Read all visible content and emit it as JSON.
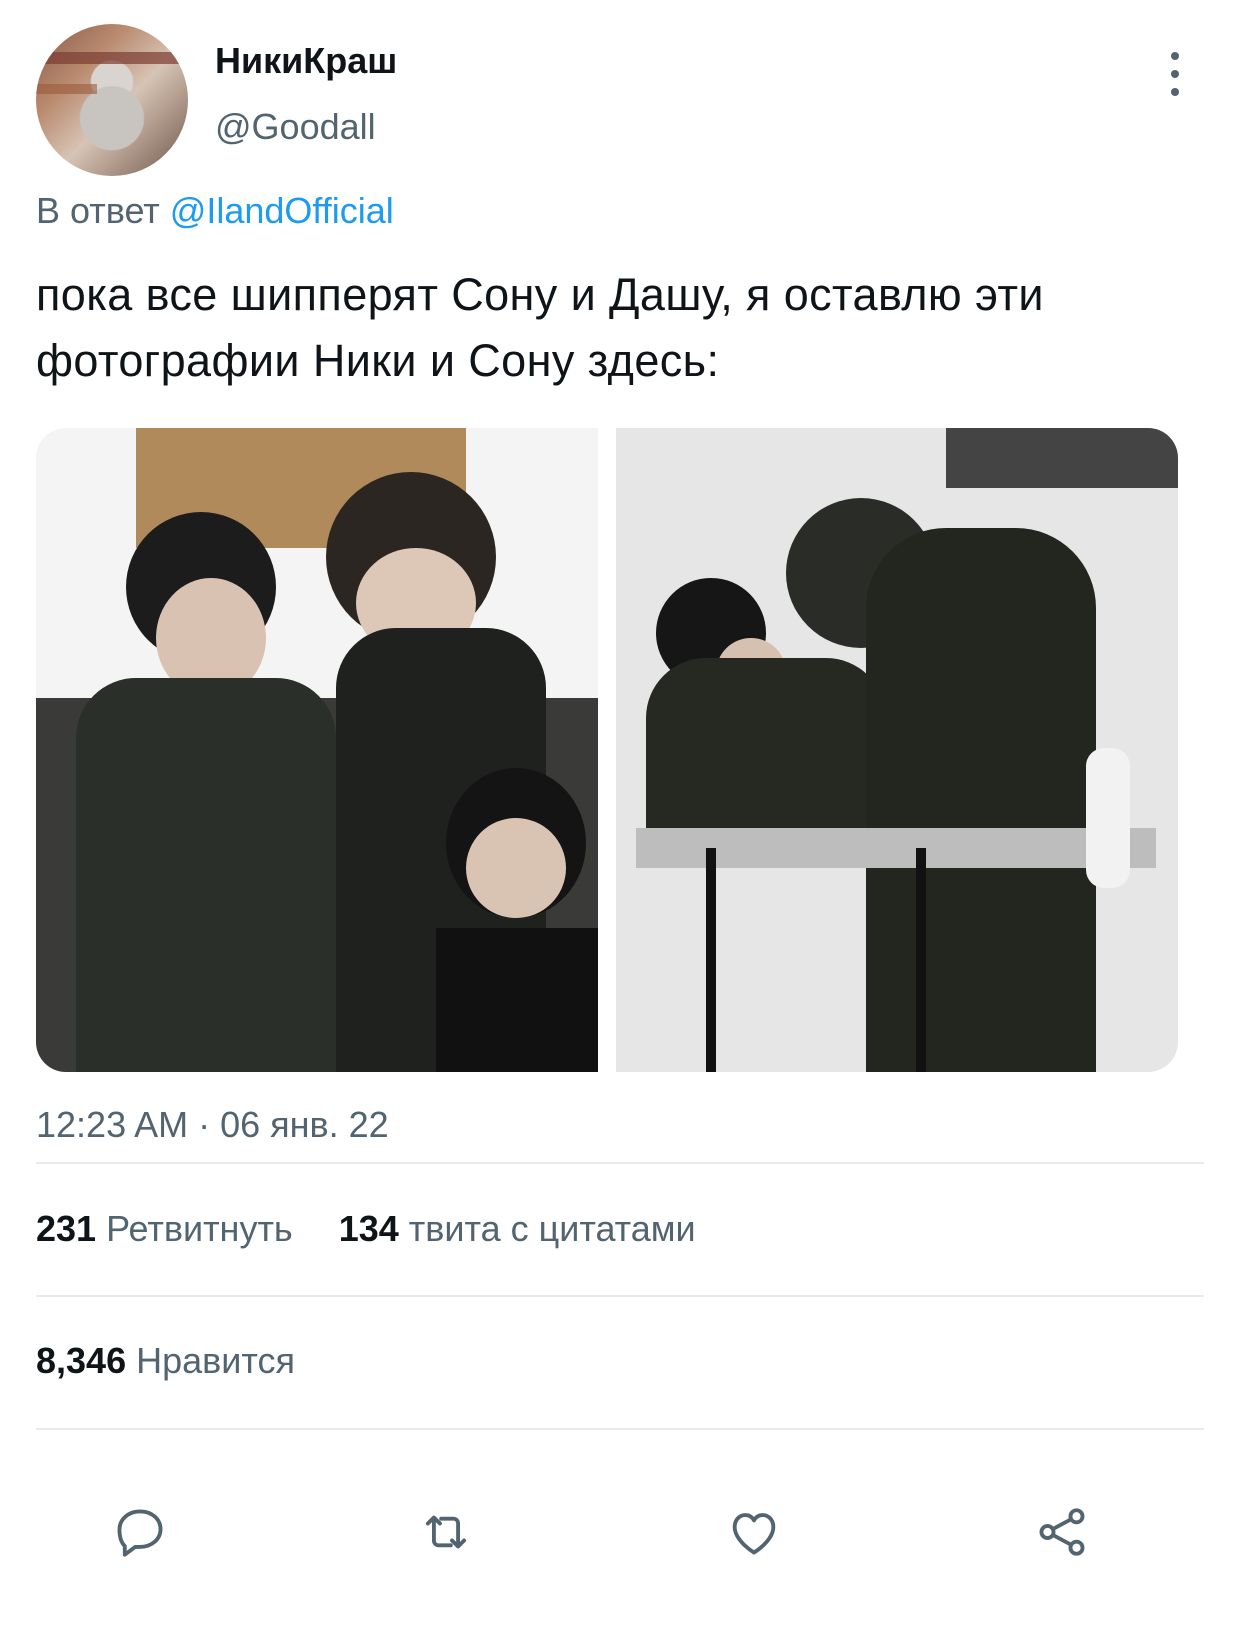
{
  "tweet": {
    "display_name": "НикиКраш",
    "handle": "@Goodall",
    "reply_prefix": "В ответ",
    "reply_to": "@IlandOfficial",
    "text": "пока все шипперят Сону и Дашу, я оставлю эти фотографии Ники и Сону здесь:",
    "timestamp": "12:23 AM · 06 янв. 22"
  },
  "stats": {
    "retweets_count": "231",
    "retweets_label": "Ретвитнуть",
    "quotes_count": "134",
    "quotes_label": "твита с цитатами",
    "likes_count": "8,346",
    "likes_label": "Нравится"
  },
  "actions": {
    "reply_icon": "reply-icon",
    "retweet_icon": "retweet-icon",
    "like_icon": "heart-icon",
    "share_icon": "share-icon"
  },
  "colors": {
    "accent": "#1d9bf0",
    "secondary_text": "#536471",
    "primary_text": "#0f1419",
    "divider": "#e7e9ea"
  }
}
